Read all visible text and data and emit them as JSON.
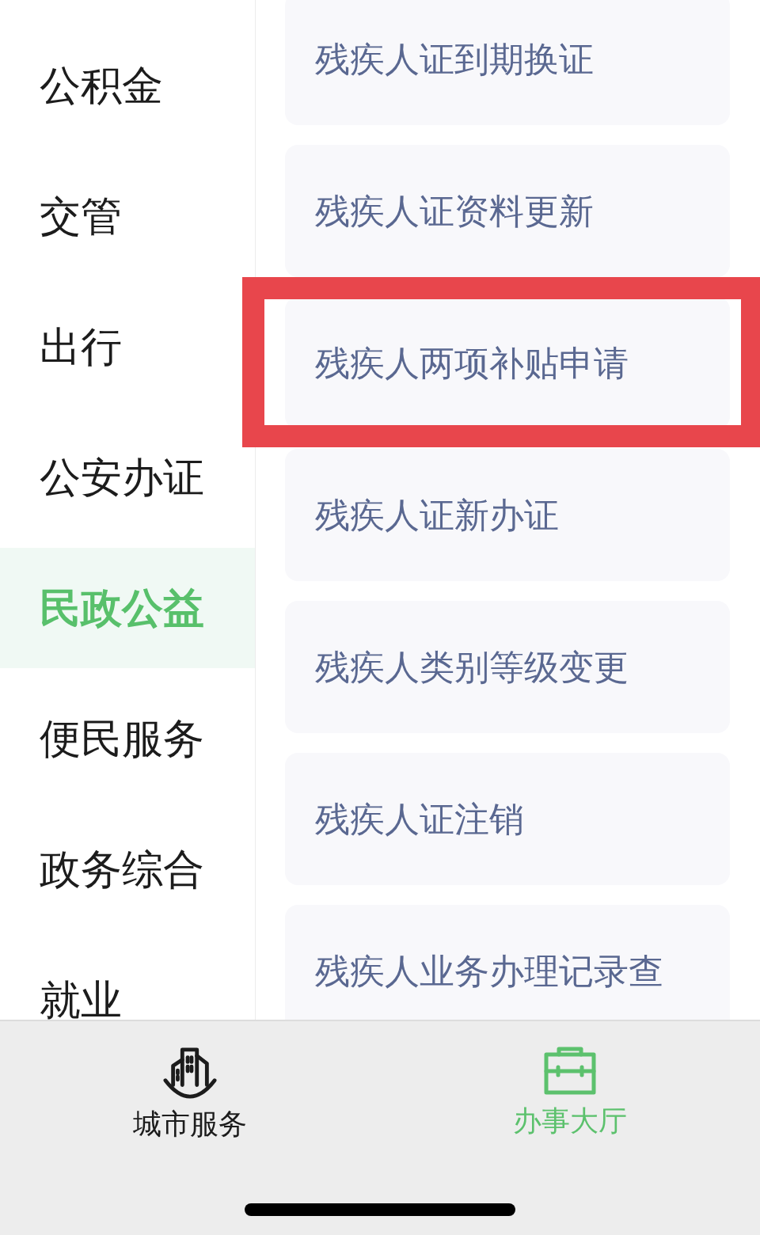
{
  "sidebar": {
    "categories": [
      {
        "label": "公积金",
        "selected": false
      },
      {
        "label": "交管",
        "selected": false
      },
      {
        "label": "出行",
        "selected": false
      },
      {
        "label": "公安办证",
        "selected": false
      },
      {
        "label": "民政公益",
        "selected": true
      },
      {
        "label": "便民服务",
        "selected": false
      },
      {
        "label": "政务综合",
        "selected": false
      },
      {
        "label": "就业",
        "selected": false
      }
    ]
  },
  "services": [
    {
      "label": "残疾人证到期换证",
      "highlighted": false
    },
    {
      "label": "残疾人证资料更新",
      "highlighted": false
    },
    {
      "label": "残疾人两项补贴申请",
      "highlighted": true
    },
    {
      "label": "残疾人证新办证",
      "highlighted": false
    },
    {
      "label": "残疾人类别等级变更",
      "highlighted": false
    },
    {
      "label": "残疾人证注销",
      "highlighted": false
    },
    {
      "label": "残疾人业务办理记录查",
      "highlighted": false
    }
  ],
  "tab_bar": {
    "tabs": [
      {
        "label": "城市服务",
        "selected": false
      },
      {
        "label": "办事大厅",
        "selected": true
      }
    ]
  }
}
